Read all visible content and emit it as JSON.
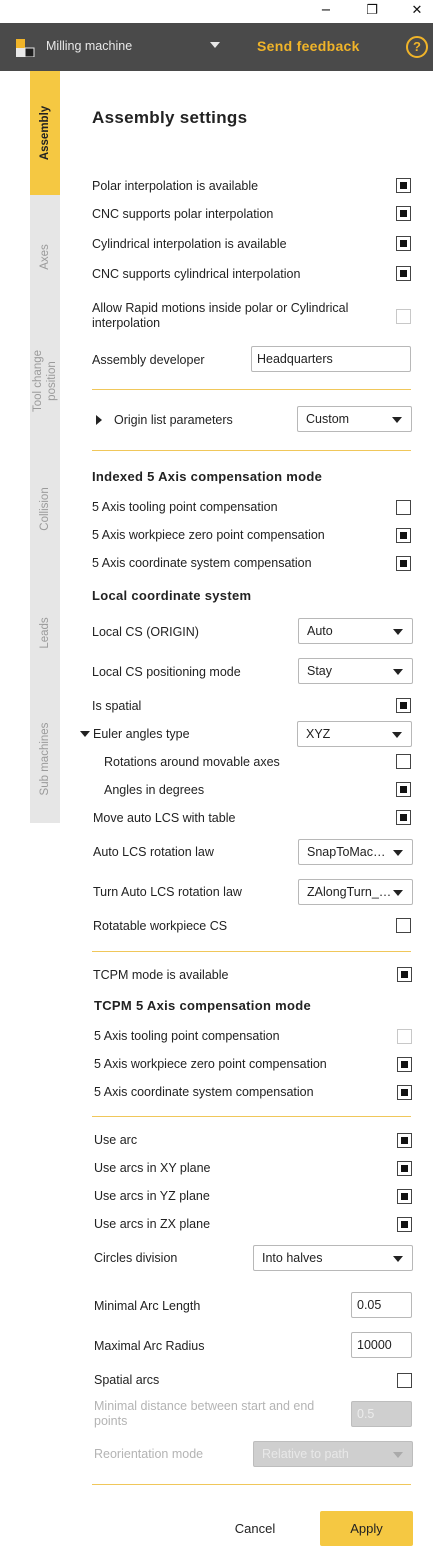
{
  "window": {
    "minimize": "−",
    "restore": "❐",
    "close": "✕"
  },
  "header": {
    "machine_name": "Milling machine",
    "feedback": "Send feedback",
    "help": "?",
    "colors": {
      "bar": "#4a4a4a",
      "accent": "#f0b429"
    }
  },
  "tabs": [
    {
      "label": "Assembly",
      "active": true
    },
    {
      "label": "Axes",
      "active": false
    },
    {
      "label": "Tool change position",
      "active": false
    },
    {
      "label": "Collision",
      "active": false
    },
    {
      "label": "Leads",
      "active": false
    },
    {
      "label": "Sub machines",
      "active": false
    }
  ],
  "title": "Assembly settings",
  "polar": [
    {
      "label": "Polar interpolation is available",
      "checked": true
    },
    {
      "label": "CNC supports polar interpolation",
      "checked": true
    },
    {
      "label": "Cylindrical interpolation is available",
      "checked": true
    },
    {
      "label": "CNC supports cylindrical interpolation",
      "checked": true
    },
    {
      "label": "Allow Rapid motions inside polar or Cylindrical interpolation",
      "checked": false
    }
  ],
  "developer": {
    "label": "Assembly developer",
    "value": "Headquarters"
  },
  "origin": {
    "label": "Origin list parameters",
    "value": "Custom"
  },
  "indexed": {
    "title": "Indexed 5 Axis compensation mode",
    "items": [
      {
        "label": "5 Axis tooling point compensation",
        "checked": false
      },
      {
        "label": "5 Axis workpiece zero point compensation",
        "checked": true
      },
      {
        "label": "5 Axis coordinate system compensation",
        "checked": true
      }
    ]
  },
  "local": {
    "title": "Local coordinate system",
    "cs_origin": {
      "label": "Local CS (ORIGIN)",
      "value": "Auto"
    },
    "positioning": {
      "label": "Local CS positioning mode",
      "value": "Stay"
    },
    "is_spatial": {
      "label": "Is spatial",
      "checked": true
    },
    "euler": {
      "label": "Euler angles type",
      "value": "XYZ"
    },
    "rotations_movable": {
      "label": "Rotations around movable axes",
      "checked": false
    },
    "angles_degrees": {
      "label": "Angles in degrees",
      "checked": true
    },
    "move_auto": {
      "label": "Move auto LCS with table",
      "checked": true
    },
    "auto_rotation": {
      "label": "Auto LCS rotation law",
      "value": "SnapToMac…"
    },
    "turn_auto_rotation": {
      "label": "Turn Auto LCS rotation law",
      "value": "ZAlongTurn_…"
    },
    "rotatable_cs": {
      "label": "Rotatable workpiece CS",
      "checked": false
    }
  },
  "tcpm": {
    "available": {
      "label": "TCPM mode is available",
      "checked": true
    },
    "title": "TCPM 5 Axis compensation mode",
    "items": [
      {
        "label": "5 Axis tooling point compensation",
        "checked": false
      },
      {
        "label": "5 Axis workpiece zero point compensation",
        "checked": true
      },
      {
        "label": "5 Axis coordinate system compensation",
        "checked": true
      }
    ]
  },
  "arcs": {
    "use_arc": {
      "label": "Use arc",
      "checked": true
    },
    "xy": {
      "label": "Use arcs in XY plane",
      "checked": true
    },
    "yz": {
      "label": "Use arcs in YZ plane",
      "checked": true
    },
    "zx": {
      "label": "Use arcs in ZX plane",
      "checked": true
    },
    "circles_division": {
      "label": "Circles division",
      "value": "Into halves"
    },
    "min_arc_length": {
      "label": "Minimal Arc Length",
      "value": "0.05"
    },
    "max_arc_radius": {
      "label": "Maximal Arc Radius",
      "value": "10000"
    },
    "spatial_arcs": {
      "label": "Spatial arcs",
      "checked": false
    },
    "min_distance": {
      "label": "Minimal distance between start and end points",
      "value": "0.5"
    },
    "reorientation": {
      "label": "Reorientation mode",
      "value": "Relative to path"
    }
  },
  "footer": {
    "cancel": "Cancel",
    "apply": "Apply"
  }
}
